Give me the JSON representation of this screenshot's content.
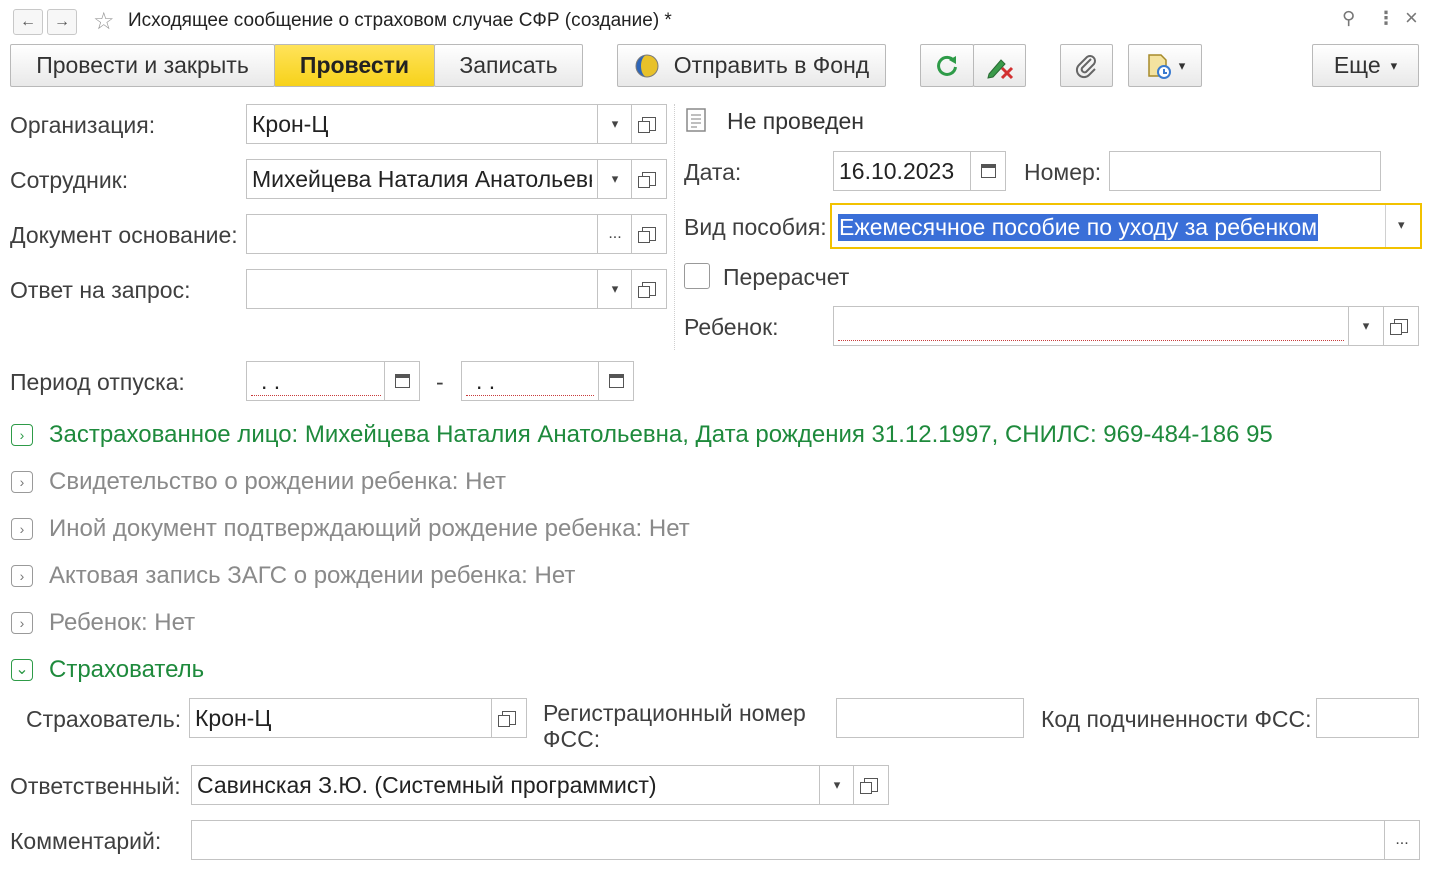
{
  "window": {
    "title": "Исходящее сообщение о страховом случае СФР (создание) *",
    "back_icon": "←",
    "forward_icon": "→",
    "star_icon": "☆",
    "link_icon": "⚲",
    "menu_icon": "⋮",
    "close_icon": "×"
  },
  "toolbar": {
    "post_close": "Провести и закрыть",
    "post": "Провести",
    "save": "Записать",
    "send_fund": "Отправить в Фонд",
    "more": "Еще",
    "dropdown_arrow": "▾"
  },
  "status": {
    "text": "Не проведен"
  },
  "fields": {
    "organization": {
      "label": "Организация:",
      "value": "Крон-Ц"
    },
    "employee": {
      "label": "Сотрудник:",
      "value": "Михейцева Наталия Анатольевна"
    },
    "basis_doc": {
      "label": "Документ основание:",
      "value": "",
      "btn": "..."
    },
    "request_reply": {
      "label": "Ответ на запрос:",
      "value": ""
    },
    "date": {
      "label": "Дата:",
      "value": "16.10.2023"
    },
    "number": {
      "label": "Номер:",
      "value": ""
    },
    "benefit_type": {
      "label": "Вид пособия:",
      "value": "Ежемесячное пособие по уходу за ребенком"
    },
    "recalc": {
      "label": "Перерасчет",
      "checked": false
    },
    "child": {
      "label": "Ребенок:",
      "value": ""
    },
    "vacation_period": {
      "label": "Период отпуска:",
      "from": " .  .",
      "to": " .  .",
      "separator": "-"
    }
  },
  "groups": [
    {
      "text": "Застрахованное лицо: Михейцева Наталия Анатольевна, Дата рождения 31.12.1997, СНИЛС: 969-484-186 95",
      "expanded": false,
      "highlight": true,
      "chevron": "›"
    },
    {
      "text": "Свидетельство о рождении ребенка: Нет",
      "expanded": false,
      "highlight": false,
      "chevron": "›"
    },
    {
      "text": "Иной документ подтверждающий рождение ребенка: Нет",
      "expanded": false,
      "highlight": false,
      "chevron": "›"
    },
    {
      "text": "Актовая запись ЗАГС о рождении ребенка: Нет",
      "expanded": false,
      "highlight": false,
      "chevron": "›"
    },
    {
      "text": "Ребенок: Нет",
      "expanded": false,
      "highlight": false,
      "chevron": "›"
    },
    {
      "text": "Страхователь",
      "expanded": true,
      "highlight": true,
      "chevron": "⌄"
    }
  ],
  "insurer": {
    "insurer": {
      "label": "Страхователь:",
      "value": "Крон-Ц"
    },
    "reg_number": {
      "label_line1": "Регистрационный номер",
      "label_line2": "ФСС:",
      "value": ""
    },
    "subordination": {
      "label": "Код подчиненности ФСС:",
      "value": ""
    }
  },
  "responsible": {
    "label": "Ответственный:",
    "value": "Савинская З.Ю. (Системный программист)"
  },
  "comment": {
    "label": "Комментарий:",
    "value": "",
    "btn": "..."
  },
  "colors": {
    "accent_yellow": "#f7d21a",
    "group_green": "#1e8a3c",
    "selection_blue": "#3a6fd8"
  }
}
